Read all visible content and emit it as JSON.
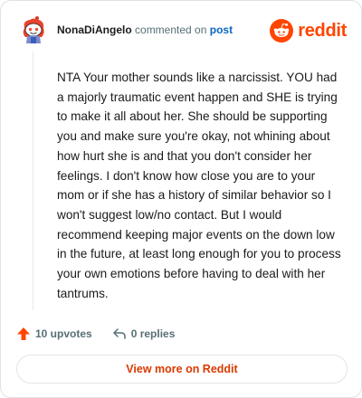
{
  "header": {
    "author": "NonaDiAngelo",
    "action_text": "commented on",
    "link_text": "post",
    "brand_name": "reddit",
    "brand_color": "#ff4500"
  },
  "comment": {
    "body": "NTA Your mother sounds like a narcissist. YOU had a majorly traumatic event happen and SHE is trying to make it all about her. She should be supporting you and make sure you're okay, not whining about how hurt she is and that you don't consider her feelings. I don't know how close you are to your mom or if she has a history of similar behavior so I won't suggest low/no contact. But I would recommend keeping major events on the down low in the future, at least long enough for you to process your own emotions before having to deal with her tantrums."
  },
  "actions": {
    "upvotes_label": "10 upvotes",
    "replies_label": "0 replies",
    "upvote_icon": "upvote-arrow-icon",
    "reply_icon": "reply-arrow-icon",
    "upvote_color": "#ff4500"
  },
  "footer": {
    "view_more_label": "View more on Reddit",
    "view_more_color": "#d93900"
  }
}
